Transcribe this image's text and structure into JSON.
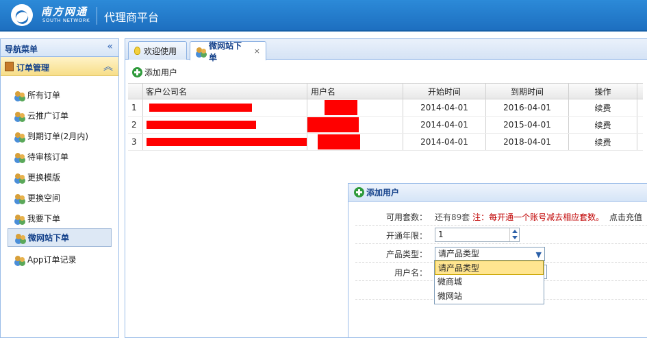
{
  "header": {
    "logo_cn": "南方网通",
    "logo_en": "SOUTH NETWORK",
    "title": "代理商平台"
  },
  "sidebar": {
    "title": "导航菜单",
    "collapse_icon": "double-chevron-left-icon",
    "group": {
      "title": "订单管理",
      "toggle_icon": "double-chevron-up-icon"
    },
    "items": [
      {
        "label": "所有订单"
      },
      {
        "label": "云推广订单"
      },
      {
        "label": "到期订单(2月内)"
      },
      {
        "label": "待审核订单"
      },
      {
        "label": "更换模版"
      },
      {
        "label": "更换空间"
      },
      {
        "label": "我要下单"
      },
      {
        "label": "微网站下单"
      },
      {
        "label": "App订单记录"
      }
    ],
    "active_item": "微网站下单"
  },
  "tabs": [
    {
      "label": "欢迎使用",
      "icon": "lightbulb-icon"
    },
    {
      "label": "微网站下单",
      "icon": "users-icon",
      "close": "×"
    }
  ],
  "toolbar": {
    "add_user_label": "添加用户"
  },
  "grid": {
    "columns": [
      "客户公司名",
      "用户名",
      "开始时间",
      "到期时间",
      "操作"
    ],
    "rows": [
      {
        "index": "1",
        "start": "2014-04-01",
        "end": "2016-04-01",
        "action": "续费"
      },
      {
        "index": "2",
        "start": "2014-04-01",
        "end": "2015-04-01",
        "action": "续费"
      },
      {
        "index": "3",
        "start": "2014-04-01",
        "end": "2018-04-01",
        "action": "续费"
      }
    ]
  },
  "dialog": {
    "title": "添加用户",
    "available_label": "可用套数：",
    "available_value": "还有89套",
    "note": "注：每开通一个账号减去相应套数。",
    "recharge": "点击充值",
    "years_label": "开通年限：",
    "years_value": "1",
    "product_label": "产品类型：",
    "product_value": "请产品类型",
    "username_label": "用户名：",
    "options": [
      "请产品类型",
      "微商城",
      "微网站"
    ]
  },
  "colors": {
    "header_blue": "#1d6fc0",
    "panel_border": "#99bbe8",
    "warning_red": "#c00000",
    "redaction": "#ff0000"
  }
}
